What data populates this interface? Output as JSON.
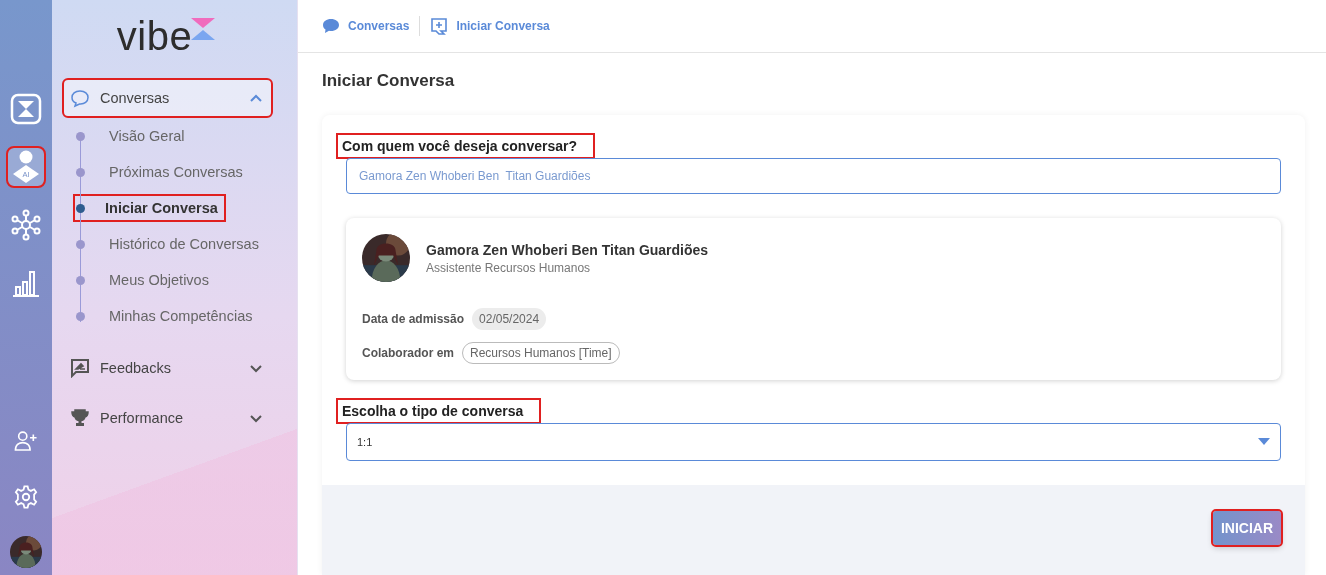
{
  "rail": {
    "items": [
      {
        "kind": "logo-mark",
        "selected": false,
        "highlighted": false
      },
      {
        "kind": "ai-person",
        "badge": "AI",
        "selected": true,
        "highlighted": true
      },
      {
        "kind": "network",
        "selected": false,
        "highlighted": false
      },
      {
        "kind": "chart",
        "selected": false,
        "highlighted": false
      }
    ],
    "bottom_items": [
      {
        "kind": "add-user"
      },
      {
        "kind": "settings"
      }
    ]
  },
  "sidebar": {
    "logo": "vibe",
    "menu": [
      {
        "label": "Conversas",
        "kind": "chat",
        "expanded": true,
        "highlighted": true,
        "children": [
          {
            "label": "Visão Geral",
            "selected": false,
            "highlighted": false
          },
          {
            "label": "Próximas Conversas",
            "selected": false,
            "highlighted": false
          },
          {
            "label": "Iniciar Conversa",
            "selected": true,
            "highlighted": true
          },
          {
            "label": "Histórico de Conversas",
            "selected": false,
            "highlighted": false
          },
          {
            "label": "Meus Objetivos",
            "selected": false,
            "highlighted": false
          },
          {
            "label": "Minhas Competências",
            "selected": false,
            "highlighted": false
          }
        ]
      },
      {
        "label": "Feedbacks",
        "kind": "feedback",
        "expanded": false,
        "highlighted": false
      },
      {
        "label": "Performance",
        "kind": "trophy",
        "expanded": false,
        "highlighted": false
      }
    ]
  },
  "breadcrumb": [
    {
      "label": "Conversas",
      "kind": "chat"
    },
    {
      "label": "Iniciar Conversa",
      "kind": "add"
    }
  ],
  "page_title": "Iniciar Conversa",
  "form": {
    "who_label": {
      "text": "Com quem você deseja conversar?",
      "highlighted": true
    },
    "who_field": {
      "value": "Gamora Zen Whoberi Ben  Titan Guardiões"
    },
    "profile": {
      "name": "Gamora Zen Whoberi Ben Titan Guardiões",
      "role": "Assistente Recursos Humanos",
      "details": [
        {
          "label": "Data de admissão",
          "value": "02/05/2024",
          "kind": "filled"
        },
        {
          "label": "Colaborador em",
          "value": "Recursos Humanos [Time]",
          "kind": "outlined"
        }
      ]
    },
    "type_label": {
      "text": "Escolha o tipo de conversa",
      "highlighted": true
    },
    "type_select": {
      "value": "1:1"
    },
    "submit": {
      "label": "INICIAR",
      "highlighted": true
    }
  }
}
